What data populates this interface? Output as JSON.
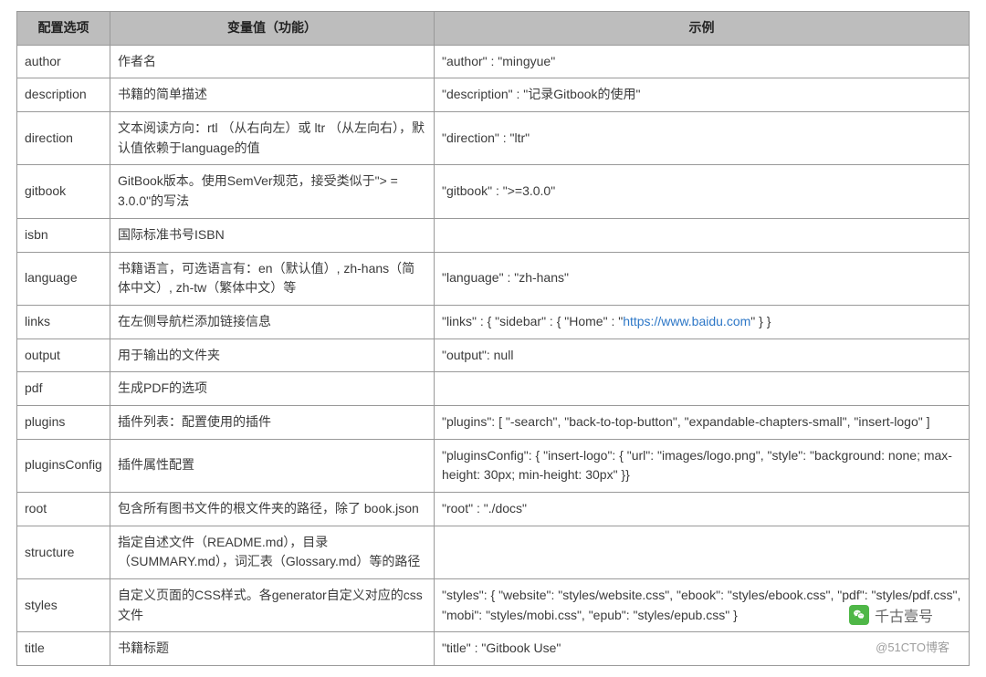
{
  "headers": {
    "col1": "配置选项",
    "col2": "变量值（功能）",
    "col3": "示例"
  },
  "rows": [
    {
      "option": "author",
      "desc": "作者名",
      "example": "\"author\" : \"mingyue\""
    },
    {
      "option": "description",
      "desc": "书籍的简单描述",
      "example": "\"description\" : \"记录Gitbook的使用\""
    },
    {
      "option": "direction",
      "desc": "文本阅读方向：rtl （从右向左）或 ltr （从左向右），默认值依赖于language的值",
      "example": "\"direction\" : \"ltr\""
    },
    {
      "option": "gitbook",
      "desc": "GitBook版本。使用SemVer规范，接受类似于\"> = 3.0.0\"的写法",
      "example": "\"gitbook\" : \">=3.0.0\""
    },
    {
      "option": "isbn",
      "desc": "国际标准书号ISBN",
      "example": ""
    },
    {
      "option": "language",
      "desc": "书籍语言，可选语言有：en（默认值）, zh-hans（简体中文）, zh-tw（繁体中文）等",
      "example": "\"language\" : \"zh-hans\""
    },
    {
      "option": "links",
      "desc": "在左侧导航栏添加链接信息",
      "example_prefix": "\"links\" : { \"sidebar\" : { \"Home\" : \"",
      "example_link": "https://www.baidu.com",
      "example_suffix": "\" } }"
    },
    {
      "option": "output",
      "desc": "用于输出的文件夹",
      "example": "\"output\": null"
    },
    {
      "option": "pdf",
      "desc": "生成PDF的选项",
      "example": ""
    },
    {
      "option": "plugins",
      "desc": "插件列表：配置使用的插件",
      "example": "\"plugins\": [ \"-search\", \"back-to-top-button\", \"expandable-chapters-small\", \"insert-logo\" ]"
    },
    {
      "option": "pluginsConfig",
      "desc": "插件属性配置",
      "example": "\"pluginsConfig\": { \"insert-logo\": { \"url\": \"images/logo.png\", \"style\": \"background: none; max-height: 30px; min-height: 30px\" }}"
    },
    {
      "option": "root",
      "desc": "包含所有图书文件的根文件夹的路径，除了 book.json",
      "example": "\"root\" : \"./docs\""
    },
    {
      "option": "structure",
      "desc": "指定自述文件（README.md），目录（SUMMARY.md），词汇表（Glossary.md）等的路径",
      "example": ""
    },
    {
      "option": "styles",
      "desc": "自定义页面的CSS样式。各generator自定义对应的css文件",
      "example": "\"styles\": { \"website\": \"styles/website.css\", \"ebook\": \"styles/ebook.css\", \"pdf\": \"styles/pdf.css\", \"mobi\": \"styles/mobi.css\", \"epub\": \"styles/epub.css\" }"
    },
    {
      "option": "title",
      "desc": "书籍标题",
      "example": "\"title\" : \"Gitbook Use\""
    }
  ],
  "watermark": "千古壹号",
  "footer": "@51CTO博客"
}
